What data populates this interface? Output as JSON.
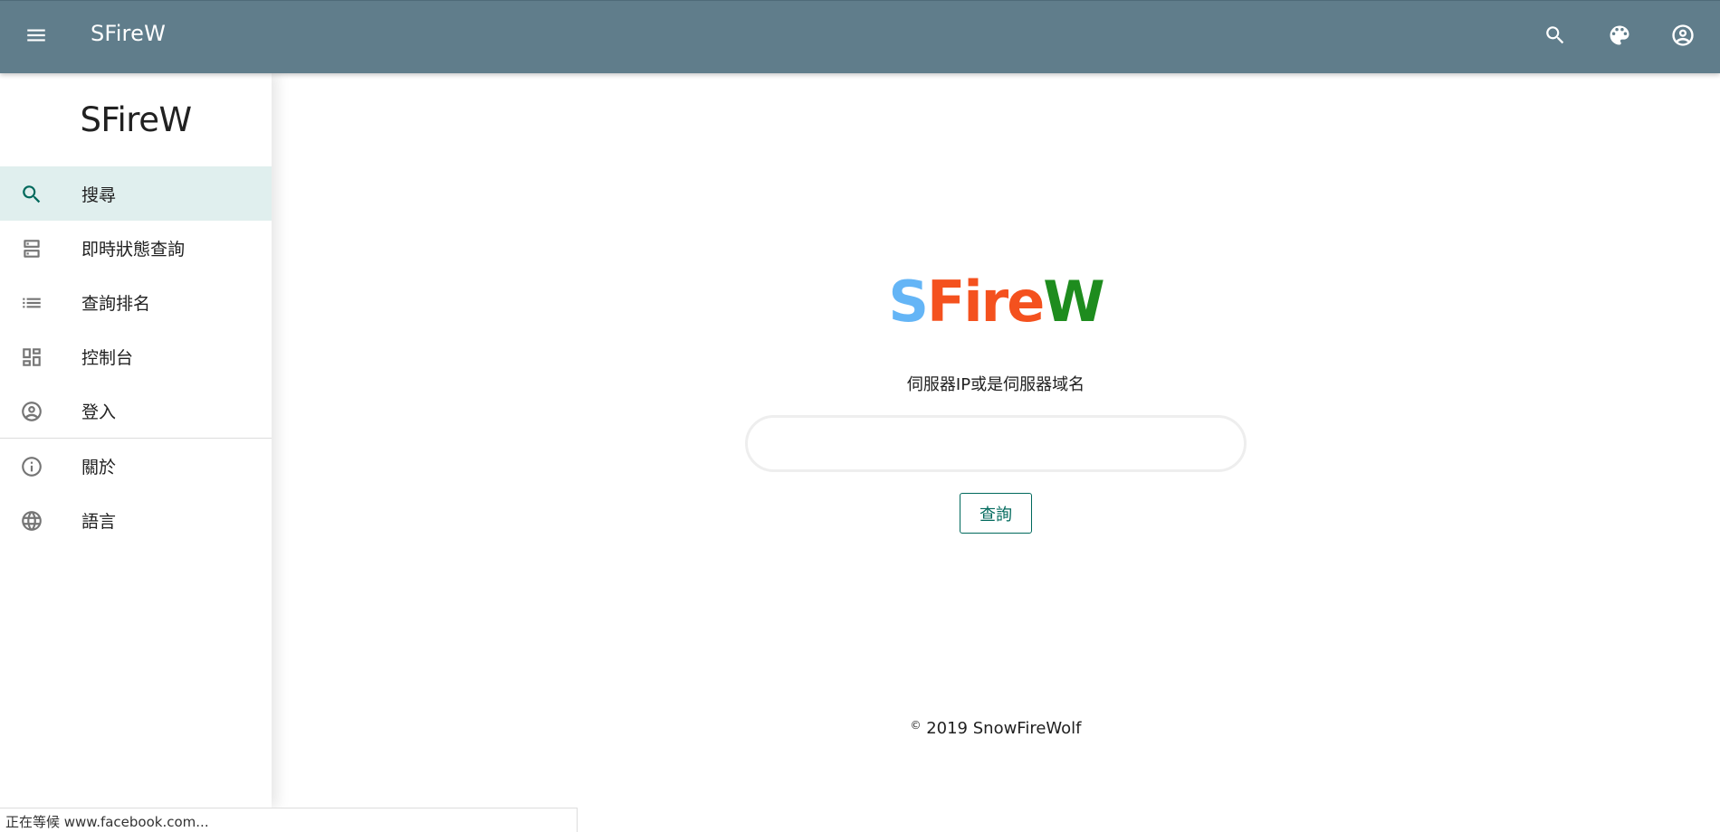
{
  "appbar": {
    "title": "SFireW",
    "icons": [
      "menu-icon",
      "search-icon",
      "palette-icon",
      "account-circle-icon"
    ]
  },
  "sidebar": {
    "brand": "SFireW",
    "items": [
      {
        "label": "搜尋",
        "icon": "search-icon",
        "active": true
      },
      {
        "label": "即時狀態查詢",
        "icon": "dns-icon"
      },
      {
        "label": "查詢排名",
        "icon": "list-icon"
      },
      {
        "label": "控制台",
        "icon": "dashboard-icon"
      },
      {
        "label": "登入",
        "icon": "account-circle-icon"
      }
    ],
    "secondary_items": [
      {
        "label": "關於",
        "icon": "info-icon"
      },
      {
        "label": "語言",
        "icon": "language-icon"
      }
    ]
  },
  "main": {
    "logo": {
      "s": "S",
      "fire": "Fire",
      "w": "W"
    },
    "field_label": "伺服器IP或是伺服器域名",
    "input_value": "",
    "query_button": "查詢",
    "footer_symbol": "©",
    "footer_text": "2019 SnowFireWolf"
  },
  "status_bar": {
    "text": "正在等候 www.facebook.com..."
  },
  "colors": {
    "appbar": "#607d8b",
    "accent": "#00695c",
    "active_bg": "#e0efee",
    "logo_s": "#64b5f6",
    "logo_fire": "#f4511e",
    "logo_w": "#1e8c1e"
  }
}
